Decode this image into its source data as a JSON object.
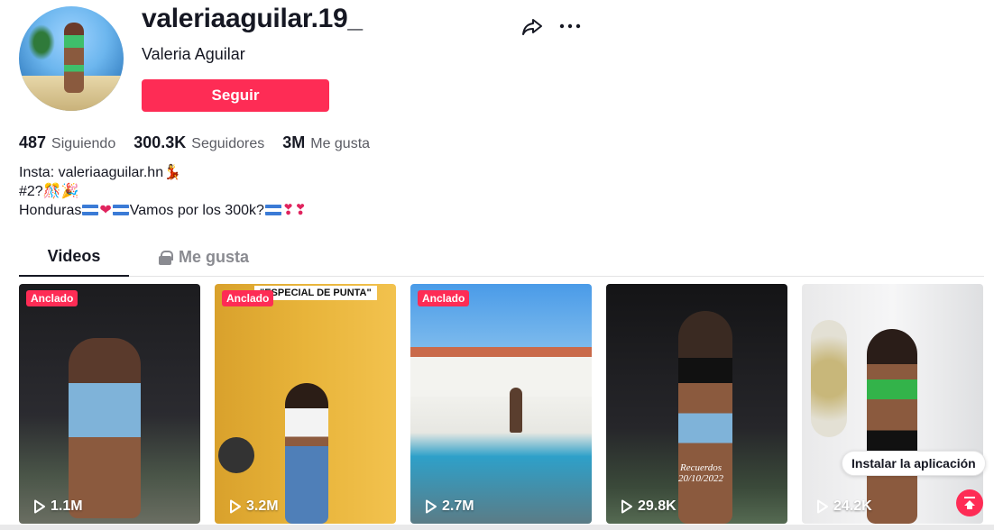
{
  "profile": {
    "username": "valeriaaguilar.19_",
    "display_name": "Valeria Aguilar",
    "follow_label": "Seguir"
  },
  "stats": [
    {
      "value": "487",
      "label": "Siguiendo"
    },
    {
      "value": "300.3K",
      "label": "Seguidores"
    },
    {
      "value": "3M",
      "label": "Me gusta"
    }
  ],
  "bio": {
    "line1": "Insta: valeriaaguilar.hn",
    "line2": "#2?",
    "line3_a": "Honduras",
    "line3_b": "Vamos por los 300k?"
  },
  "tabs": {
    "videos": "Videos",
    "likes": "Me gusta"
  },
  "videos": [
    {
      "pinned_label": "Anclado",
      "views": "1.1M",
      "caption": ""
    },
    {
      "pinned_label": "Anclado",
      "views": "3.2M",
      "caption": "\"ESPECIAL DE PUNTA\""
    },
    {
      "pinned_label": "Anclado",
      "views": "2.7M",
      "caption": ""
    },
    {
      "pinned_label": "",
      "views": "29.8K",
      "caption": "Recuerdos 20/10/2022"
    },
    {
      "pinned_label": "",
      "views": "24.2K",
      "caption": ""
    }
  ],
  "install_app": "Instalar la aplicación",
  "colors": {
    "accent": "#fe2c55",
    "text": "#161823",
    "muted": "#8a8b91"
  }
}
